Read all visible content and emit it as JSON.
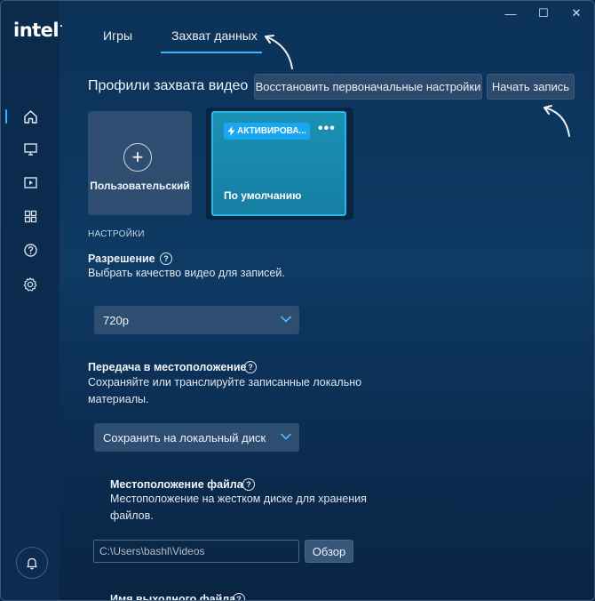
{
  "brand": {
    "logo": "intel"
  },
  "window": {
    "minimize": "—",
    "maximize": "☐",
    "close": "✕"
  },
  "tabs": [
    {
      "label": "Игры",
      "active": false
    },
    {
      "label": "Захват данных",
      "active": true
    }
  ],
  "profiles": {
    "title": "Профили захвата видео",
    "reset_button": "Восстановить первоначальные настройки",
    "start_button": "Начать запись",
    "custom_card": {
      "label": "Пользовательский"
    },
    "default_card": {
      "badge": "АКТИВИРОВА...",
      "label": "По умолчанию",
      "menu": "•••"
    }
  },
  "settings": {
    "heading": "НАСТРОЙКИ",
    "resolution": {
      "label": "Разрешение",
      "help": "?",
      "desc": "Выбрать качество видео для записей.",
      "value": "720p"
    },
    "destination": {
      "label": "Передача в местоположение",
      "help": "?",
      "desc_line1": "Сохраняйте или транслируйте записанные локально",
      "desc_line2": "материалы.",
      "value": "Сохранить на локальный диск"
    },
    "file_location": {
      "label": "Местоположение файла",
      "help": "?",
      "desc_line1": "Местоположение на жестком диске для хранения",
      "desc_line2": "файлов.",
      "path": "C:\\Users\\bashl\\Videos",
      "browse": "Обзор"
    },
    "output_name": {
      "label": "Имя выходного файла",
      "help": "?"
    }
  },
  "colors": {
    "accent": "#36b4ff",
    "active_card": "#1a92b4",
    "background": "#0c3258"
  }
}
